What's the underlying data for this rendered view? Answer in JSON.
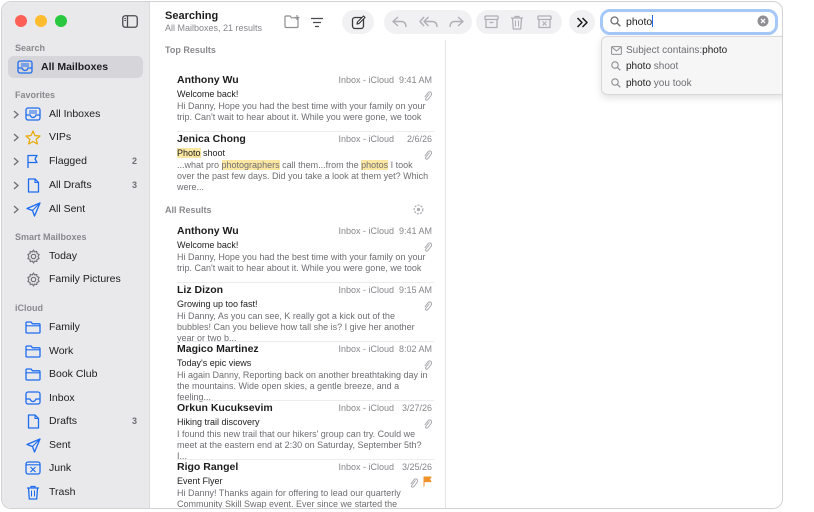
{
  "sidebar": {
    "sections": {
      "search": "Search",
      "favorites": "Favorites",
      "smart": "Smart Mailboxes",
      "icloud": "iCloud"
    },
    "search_items": [
      {
        "label": "All Mailboxes",
        "icon": "tray-icon"
      }
    ],
    "favorites": [
      {
        "label": "All Inboxes",
        "icon": "tray-icon",
        "count": ""
      },
      {
        "label": "VIPs",
        "icon": "star-icon",
        "count": ""
      },
      {
        "label": "Flagged",
        "icon": "flag-icon",
        "count": "2"
      },
      {
        "label": "All Drafts",
        "icon": "document-icon",
        "count": "3"
      },
      {
        "label": "All Sent",
        "icon": "paperplane-icon",
        "count": ""
      }
    ],
    "smart": [
      {
        "label": "Today",
        "icon": "gear-icon"
      },
      {
        "label": "Family Pictures",
        "icon": "gear-icon"
      }
    ],
    "icloud": [
      {
        "label": "Family",
        "icon": "folder-icon",
        "count": ""
      },
      {
        "label": "Work",
        "icon": "folder-icon",
        "count": ""
      },
      {
        "label": "Book Club",
        "icon": "folder-icon",
        "count": ""
      },
      {
        "label": "Inbox",
        "icon": "tray-icon",
        "count": ""
      },
      {
        "label": "Drafts",
        "icon": "document-icon",
        "count": "3"
      },
      {
        "label": "Sent",
        "icon": "paperplane-icon",
        "count": ""
      },
      {
        "label": "Junk",
        "icon": "junk-icon",
        "count": ""
      },
      {
        "label": "Trash",
        "icon": "trash-icon",
        "count": ""
      }
    ]
  },
  "toolbar": {
    "title": "Searching",
    "subtitle": "All Mailboxes, 21 results"
  },
  "search": {
    "value": "photo",
    "suggestions": [
      {
        "prefix": "Subject contains: ",
        "match": "photo",
        "suffix": "",
        "icon": "envelope-icon"
      },
      {
        "prefix": "",
        "match": "photo",
        "suffix": " shoot",
        "icon": "search-icon"
      },
      {
        "prefix": "",
        "match": "photo",
        "suffix": " you took",
        "icon": "search-icon"
      }
    ]
  },
  "list": {
    "top_header": "Top Results",
    "all_header": "All Results",
    "top_results": [
      {
        "sender": "Anthony Wu",
        "mailbox": "Inbox - iCloud",
        "date": "9:41 AM",
        "subject": "Welcome back!",
        "preview": "Hi Danny, Hope you had the best time with your family on your trip. Can't wait to hear about it. While you were gone, we took"
      },
      {
        "sender": "Jenica Chong",
        "mailbox": "Inbox - iCloud",
        "date": "2/6/26",
        "subject_hl": "Photo",
        "subject_rest": " shoot",
        "preview_parts": [
          "...what pro ",
          "photographers",
          " call them...from the ",
          "photos",
          " I took over the past few days. Did you take a look at them yet? Which were..."
        ]
      }
    ],
    "all_results": [
      {
        "sender": "Anthony Wu",
        "mailbox": "Inbox - iCloud",
        "date": "9:41 AM",
        "subject": "Welcome back!",
        "preview": "Hi Danny, Hope you had the best time with your family on your trip. Can't wait to hear about it. While you were gone, we took"
      },
      {
        "sender": "Liz Dizon",
        "mailbox": "Inbox - iCloud",
        "date": "9:15 AM",
        "subject": "Growing up too fast!",
        "preview": "Hi Danny, As you can see, K really got a kick out of the bubbles! Can you believe how tall she is? I give her another year or two b..."
      },
      {
        "sender": "Magico Martinez",
        "mailbox": "Inbox - iCloud",
        "date": "8:02 AM",
        "subject": "Today's epic views",
        "preview": "Hi again Danny, Reporting back on another breathtaking day in the mountains. Wide open skies, a gentle breeze, and a feeling..."
      },
      {
        "sender": "Orkun Kucuksevim",
        "mailbox": "Inbox - iCloud",
        "date": "3/27/26",
        "subject": "Hiking trail discovery",
        "preview": "I found this new trail that our hikers' group can try. Could we meet at the eastern end at 2:30 on Saturday, September 5th? I..."
      },
      {
        "sender": "Rigo Rangel",
        "mailbox": "Inbox - iCloud",
        "date": "3/25/26",
        "subject": "Event Flyer",
        "preview": "Hi Danny! Thanks again for offering to lead our quarterly Community Skill Swap event. Ever since we started the series,..."
      }
    ]
  },
  "colors": {
    "accent": "#1d6cf0",
    "flag": "#f0932b",
    "highlight": "#fbe7a1"
  }
}
